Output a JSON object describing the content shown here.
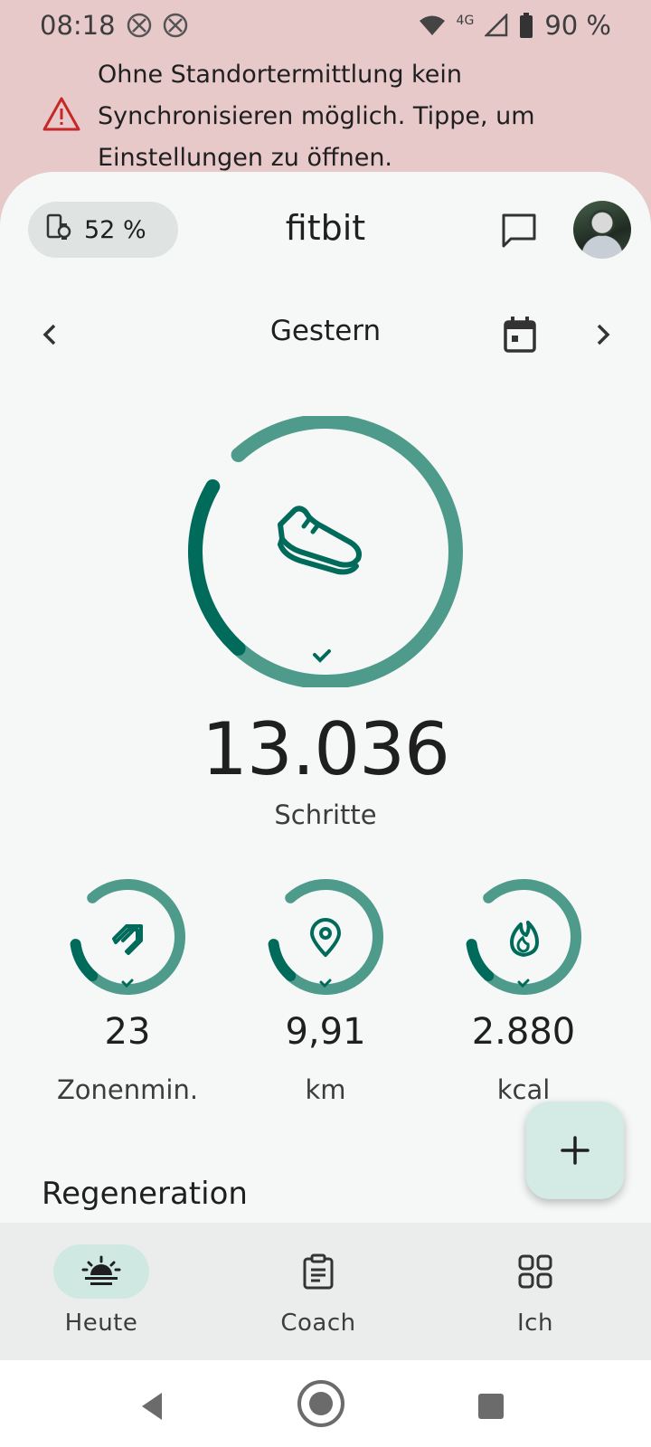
{
  "status_bar": {
    "time": "08:18",
    "network": "4G",
    "battery": "90 %"
  },
  "banner": {
    "text": "Ohne Standortermittlung kein Synchronisieren möglich. Tippe, um Einstellungen zu öffnen.",
    "icon": "warning-icon",
    "icon_color": "#c62828"
  },
  "header": {
    "device_battery": "52 %",
    "app_title": "fitbit"
  },
  "date_nav": {
    "label": "Gestern"
  },
  "steps": {
    "value": "13.036",
    "label": "Schritte",
    "progress": 1.0,
    "goal_reached": true
  },
  "stats": [
    {
      "value": "23",
      "label": "Zonenmin.",
      "icon": "zone-minutes-icon",
      "goal_reached": true
    },
    {
      "value": "9,91",
      "label": "km",
      "icon": "location-pin-icon",
      "goal_reached": true
    },
    {
      "value": "2.880",
      "label": "kcal",
      "icon": "flame-icon",
      "goal_reached": true
    }
  ],
  "section": {
    "title": "Regeneration"
  },
  "bottom_nav": {
    "items": [
      {
        "label": "Heute",
        "icon": "sunrise-icon",
        "active": true
      },
      {
        "label": "Coach",
        "icon": "clipboard-icon",
        "active": false
      },
      {
        "label": "Ich",
        "icon": "grid-icon",
        "active": false
      }
    ]
  },
  "colors": {
    "accent": "#006b5b",
    "ring": "#4e9a8b",
    "banner_bg": "#e7c9ca",
    "fab_bg": "#d3ebe4"
  }
}
